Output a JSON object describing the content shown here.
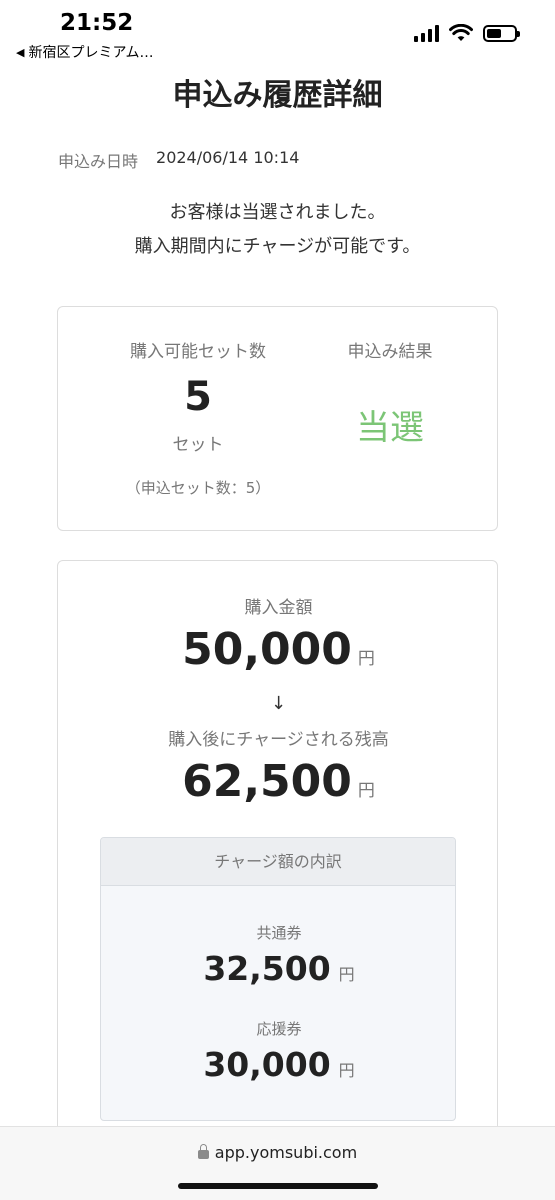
{
  "status_bar": {
    "time": "21:52",
    "back_app": "新宿区プレミアム…"
  },
  "page": {
    "title": "申込み履歴詳細",
    "date_label": "申込み日時",
    "date_value": "2024/06/14 10:14",
    "message_line1": "お客様は当選されました。",
    "message_line2": "購入期間内にチャージが可能です。"
  },
  "sets_card": {
    "label": "購入可能セット数",
    "count": "5",
    "unit": "セット",
    "note": "（申込セット数：5）",
    "result_label": "申込み結果",
    "result_value": "当選"
  },
  "amount_card": {
    "purchase_label": "購入金額",
    "purchase_amount": "50,000",
    "yen": "円",
    "arrow": "↓",
    "balance_label": "購入後にチャージされる残高",
    "balance_amount": "62,500",
    "breakdown_title": "チャージ額の内訳",
    "common_label": "共通券",
    "common_amount": "32,500",
    "support_label": "応援券",
    "support_amount": "30,000"
  },
  "browser": {
    "url": "app.yomsubi.com"
  },
  "colors": {
    "won": "#7cc576",
    "label_gray": "#777777"
  }
}
